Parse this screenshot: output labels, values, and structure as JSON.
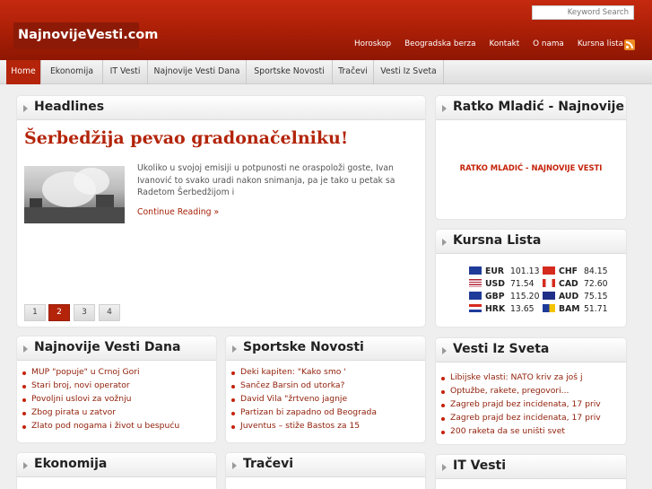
{
  "site": {
    "logo": "NajnovijeVesti.com",
    "search_label": "Keyword Search",
    "toplinks": [
      "Horoskop",
      "Beogradska berza",
      "Kontakt",
      "O nama",
      "Kursna lista"
    ]
  },
  "nav": [
    "Home",
    "Ekonomija",
    "IT Vesti",
    "Najnovije Vesti Dana",
    "Sportske Novosti",
    "Tračevi",
    "Vesti Iz Sveta"
  ],
  "headlines": {
    "title": "Headlines",
    "story_title": "Šerbedžija pevao gradonačelniku!",
    "text": "Ukoliko u svojoj emisiji u potpunosti ne oraspoloži goste, Ivan Ivanović to svako uradi nakon snimanja, pa je tako u petak sa Radetom Šerbedžijom i",
    "more": "Continue Reading »",
    "pages": [
      "1",
      "2",
      "3",
      "4"
    ],
    "current_page": "2"
  },
  "mladic": {
    "title": "Ratko Mladić - Najnovije",
    "link": "RATKO MLADIĆ - NAJNOVIJE VESTI"
  },
  "kursna": {
    "title": "Kursna Lista",
    "rates": [
      {
        "code": "EUR",
        "value": "101.13",
        "flag": "eu-flag-icon"
      },
      {
        "code": "CHF",
        "value": "84.15",
        "flag": "swiss-flag-icon"
      },
      {
        "code": "USD",
        "value": "71.54",
        "flag": "us-flag-icon"
      },
      {
        "code": "CAD",
        "value": "72.60",
        "flag": "canada-flag-icon"
      },
      {
        "code": "GBP",
        "value": "115.20",
        "flag": "uk-flag-icon"
      },
      {
        "code": "AUD",
        "value": "75.15",
        "flag": "australia-flag-icon"
      },
      {
        "code": "HRK",
        "value": "13.65",
        "flag": "croatia-flag-icon"
      },
      {
        "code": "BAM",
        "value": "51.71",
        "flag": "bosnia-flag-icon"
      }
    ]
  },
  "najnovije": {
    "title": "Najnovije Vesti Dana",
    "items": [
      "MUP \"popuje\" u Crnoj Gori",
      "Stari broj, novi operator",
      "Povoljni uslovi za vožnju",
      "Zbog pirata u zatvor",
      "Zlato pod nogama i život u bespuću"
    ]
  },
  "sportske": {
    "title": "Sportske Novosti",
    "items": [
      "Deki kapiten: \"Kako smo '",
      "Sančez Barsin od utorka?",
      "David Vila \"žrtveno jagnje",
      "Partizan bi zapadno od Beograda",
      "Juventus – stiže Bastos za 15"
    ]
  },
  "svet": {
    "title": "Vesti Iz Sveta",
    "items": [
      "Libijske vlasti: NATO kriv za još j",
      "Optužbe, rakete, pregovori...",
      "Zagreb prajd bez incidenata, 17 priv",
      "Zagreb prajd bez incidenata, 17 priv",
      "200 raketa da se uništi svet"
    ]
  },
  "ekonomija": {
    "title": "Ekonomija"
  },
  "tracevi": {
    "title": "Tračevi"
  },
  "itvesti": {
    "title": "IT Vesti"
  },
  "colors": {
    "brand": "#b3240a",
    "link": "#8f1d07"
  }
}
